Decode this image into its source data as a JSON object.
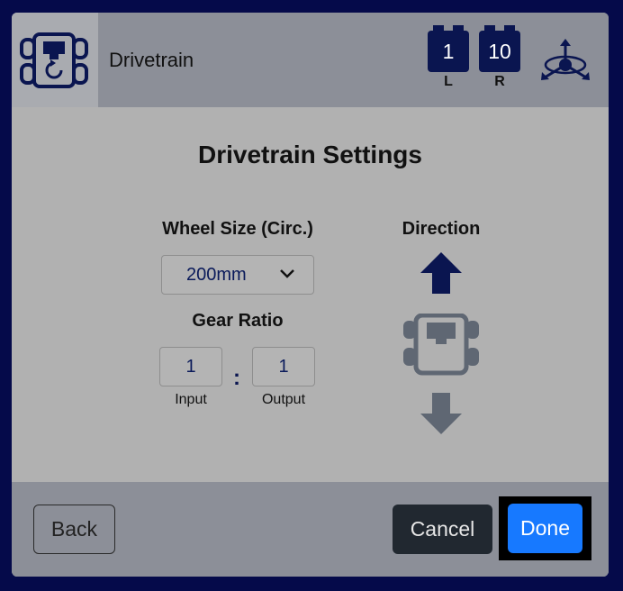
{
  "header": {
    "title": "Drivetrain",
    "ports": [
      {
        "number": "1",
        "label": "L"
      },
      {
        "number": "10",
        "label": "R"
      }
    ]
  },
  "settings": {
    "title": "Drivetrain Settings",
    "wheel_size_label": "Wheel Size (Circ.)",
    "wheel_size_value": "200mm",
    "gear_ratio_label": "Gear Ratio",
    "gear_input_value": "1",
    "gear_output_value": "1",
    "input_label": "Input",
    "output_label": "Output",
    "direction_label": "Direction"
  },
  "footer": {
    "back_label": "Back",
    "cancel_label": "Cancel",
    "done_label": "Done"
  },
  "colors": {
    "background": "#050a4a",
    "panel": "#b1b1b1",
    "header": "#8c8f98",
    "port": "#0a1550",
    "done": "#1779ff",
    "cancel": "#212830"
  },
  "icons": [
    "drivetrain-device-icon",
    "gyro-axes-icon",
    "chevron-down-icon",
    "arrow-up-icon",
    "robot-topview-icon",
    "arrow-down-icon"
  ]
}
